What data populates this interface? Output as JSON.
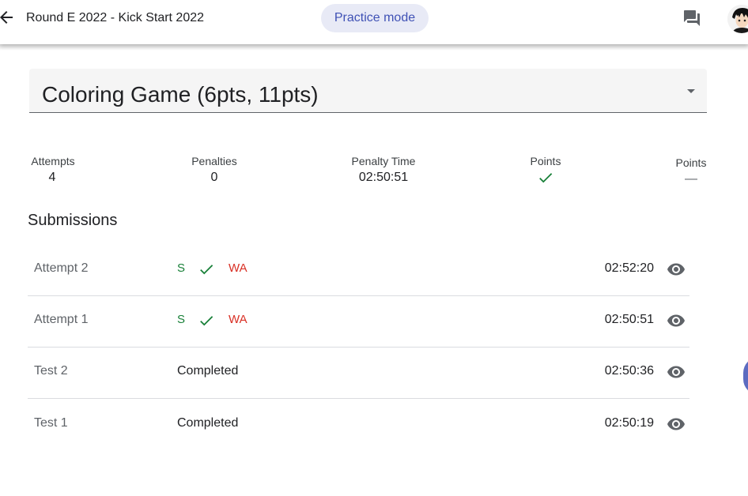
{
  "header": {
    "title": "Round E 2022 - Kick Start 2022",
    "mode_chip": "Practice mode",
    "back_icon": "arrow-left-icon",
    "chat_icon": "chat-forum-icon",
    "avatar_icon": "user-avatar"
  },
  "problem": {
    "selected": "Coloring Game (6pts, 11pts)",
    "dropdown_icon": "dropdown-arrow-icon"
  },
  "stats": {
    "attempts": {
      "label": "Attempts",
      "value": "4"
    },
    "penalties": {
      "label": "Penalties",
      "value": "0"
    },
    "penalty_time": {
      "label": "Penalty Time",
      "value": "02:50:51"
    },
    "points_1": {
      "label": "Points",
      "status": "check"
    },
    "points_2": {
      "label": "Points",
      "value": "—"
    }
  },
  "submissions": {
    "title": "Submissions",
    "rows": [
      {
        "name": "Attempt 2",
        "verdict_small": "S",
        "verdict_large": "WA",
        "time": "02:52:20"
      },
      {
        "name": "Attempt 1",
        "verdict_small": "S",
        "verdict_large": "WA",
        "time": "02:50:51"
      },
      {
        "name": "Test 2",
        "status": "Completed",
        "time": "02:50:36"
      },
      {
        "name": "Test 1",
        "status": "Completed",
        "time": "02:50:19"
      }
    ]
  },
  "colors": {
    "accent": "#3f51b5",
    "chip_bg": "#e8eaf6",
    "success": "#188038",
    "error": "#d93025",
    "fab": "#5c6bc0"
  }
}
